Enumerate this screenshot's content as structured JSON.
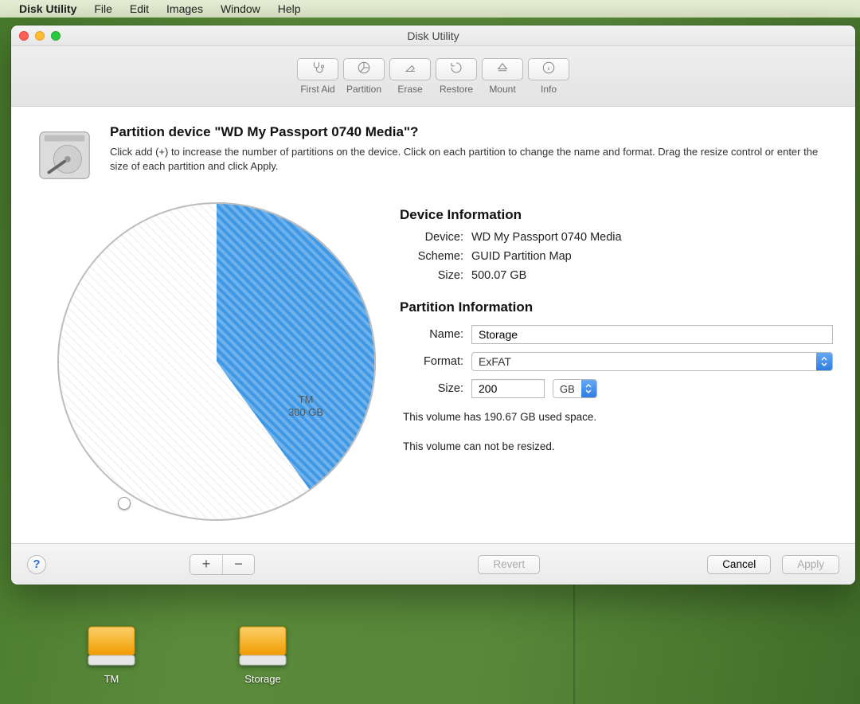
{
  "menubar": {
    "app": "Disk Utility",
    "items": [
      "File",
      "Edit",
      "Images",
      "Window",
      "Help"
    ]
  },
  "window": {
    "title": "Disk Utility"
  },
  "toolbar": {
    "first_aid": "First Aid",
    "partition": "Partition",
    "erase": "Erase",
    "restore": "Restore",
    "mount": "Mount",
    "info": "Info"
  },
  "sheet": {
    "title": "Partition device \"WD My Passport 0740 Media\"?",
    "description": "Click add (+) to increase the number of partitions on the device. Click on each partition to change the name and format. Drag the resize control or enter the size of each partition and click Apply."
  },
  "chart_data": {
    "type": "pie",
    "title": "",
    "slices": [
      {
        "name": "Storage",
        "size_label": "200 GB",
        "value_gb": 200,
        "color": "#3f98e5",
        "selected": true
      },
      {
        "name": "TM",
        "size_label": "300 GB",
        "value_gb": 300,
        "color": "#ffffff",
        "selected": false
      }
    ],
    "total_gb": 500
  },
  "device_info": {
    "heading": "Device Information",
    "device_k": "Device:",
    "device_v": "WD My Passport 0740 Media",
    "scheme_k": "Scheme:",
    "scheme_v": "GUID Partition Map",
    "size_k": "Size:",
    "size_v": "500.07 GB"
  },
  "partition_info": {
    "heading": "Partition Information",
    "name_k": "Name:",
    "name_v": "Storage",
    "format_k": "Format:",
    "format_v": "ExFAT",
    "size_k": "Size:",
    "size_v": "200",
    "unit_v": "GB",
    "used_note": "This volume has 190.67 GB used space.",
    "resize_note": "This volume can not be resized."
  },
  "buttons": {
    "revert": "Revert",
    "cancel": "Cancel",
    "apply": "Apply",
    "plus": "+",
    "minus": "−",
    "help": "?"
  },
  "desktop": {
    "drive1": "TM",
    "drive2": "Storage"
  }
}
